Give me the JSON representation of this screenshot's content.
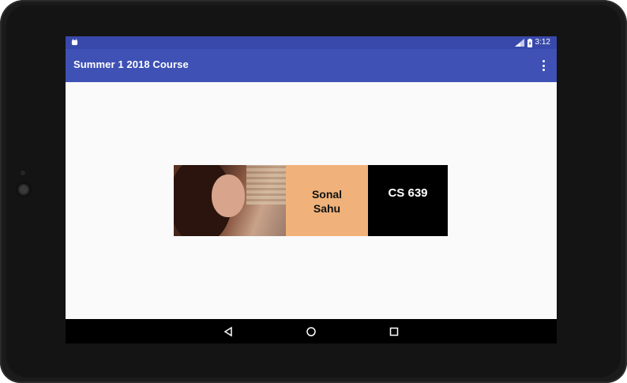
{
  "status_bar": {
    "time": "3:12"
  },
  "app_bar": {
    "title": "Summer 1 2018 Course"
  },
  "card": {
    "name_line1": "Sonal",
    "name_line2": "Sahu",
    "course": "CS 639"
  },
  "colors": {
    "status_bar": "#3949ab",
    "app_bar": "#3f51b5",
    "name_panel": "#f0b27a",
    "course_panel": "#000000",
    "fab": "#ff4081"
  },
  "icons": {
    "fab": "email-icon",
    "overflow": "overflow-menu-icon",
    "nav": [
      "back-icon",
      "home-icon",
      "recents-icon"
    ]
  }
}
